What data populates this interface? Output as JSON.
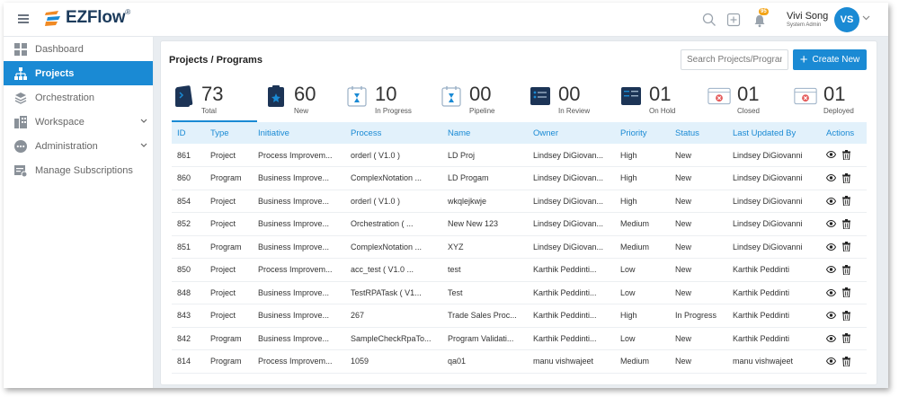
{
  "app": {
    "logo_text": "EZFlow",
    "logo_sup": "®"
  },
  "header": {
    "notification_count": "95",
    "user_name": "Vivi Song",
    "user_role": "System Admin",
    "avatar_initials": "VS"
  },
  "sidebar": {
    "items": [
      {
        "label": "Dashboard",
        "icon": "grid-icon"
      },
      {
        "label": "Projects",
        "icon": "sitemap-icon"
      },
      {
        "label": "Orchestration",
        "icon": "layers-icon"
      },
      {
        "label": "Workspace",
        "icon": "workspace-icon"
      },
      {
        "label": "Administration",
        "icon": "ellipsis-circle-icon"
      },
      {
        "label": "Manage Subscriptions",
        "icon": "subscription-icon"
      }
    ]
  },
  "page": {
    "breadcrumb": "Projects /  Programs",
    "search_placeholder": "Search Projects/Programs",
    "create_label": "Create New"
  },
  "stats": [
    {
      "value": "73",
      "label": "Total"
    },
    {
      "value": "60",
      "label": "New"
    },
    {
      "value": "10",
      "label": "In Progress"
    },
    {
      "value": "00",
      "label": "Pipeline"
    },
    {
      "value": "00",
      "label": "In Review"
    },
    {
      "value": "01",
      "label": "On Hold"
    },
    {
      "value": "01",
      "label": "Closed"
    },
    {
      "value": "01",
      "label": "Deployed"
    }
  ],
  "table": {
    "columns": [
      "ID",
      "Type",
      "Initiative",
      "Process",
      "Name",
      "Owner",
      "Priority",
      "Status",
      "Last Updated By",
      "Actions"
    ],
    "rows": [
      [
        "861",
        "Project",
        "Process Improvem...",
        "orderl ( V1.0 )",
        "LD Proj",
        "Lindsey DiGiovan...",
        "High",
        "New",
        "Lindsey DiGiovanni"
      ],
      [
        "860",
        "Program",
        "Business Improve...",
        "ComplexNotation ...",
        "LD Progam",
        "Lindsey DiGiovan...",
        "High",
        "New",
        "Lindsey DiGiovanni"
      ],
      [
        "854",
        "Project",
        "Business Improve...",
        "orderl ( V1.0 )",
        "wkqlejkwje",
        "Lindsey DiGiovan...",
        "High",
        "New",
        "Lindsey DiGiovanni"
      ],
      [
        "852",
        "Project",
        "Business Improve...",
        "Orchestration ( ...",
        "New New 123",
        "Lindsey DiGiovan...",
        "Medium",
        "New",
        "Lindsey DiGiovanni"
      ],
      [
        "851",
        "Program",
        "Business Improve...",
        "ComplexNotation ...",
        "XYZ",
        "Lindsey DiGiovan...",
        "Medium",
        "New",
        "Lindsey DiGiovanni"
      ],
      [
        "850",
        "Project",
        "Process Improvem...",
        "acc_test ( V1.0 ...",
        "test",
        "Karthik Peddinti...",
        "Low",
        "New",
        "Karthik Peddinti"
      ],
      [
        "848",
        "Project",
        "Business Improve...",
        "TestRPATask ( V1...",
        "Test",
        "Karthik Peddinti...",
        "Low",
        "New",
        "Karthik Peddinti"
      ],
      [
        "843",
        "Project",
        "Business Improve...",
        "267",
        "Trade Sales Proc...",
        "Karthik Peddinti...",
        "High",
        "In Progress",
        "Karthik Peddinti"
      ],
      [
        "842",
        "Program",
        "Business Improve...",
        "SampleCheckRpaTo...",
        "Program Validati...",
        "Karthik Peddinti...",
        "Low",
        "New",
        "Karthik Peddinti"
      ],
      [
        "814",
        "Program",
        "Process Improvem...",
        "1059",
        "qa01",
        "manu vishwajeet",
        "Medium",
        "New",
        "manu vishwajeet"
      ]
    ]
  },
  "colors": {
    "accent": "#1a8ad4",
    "header_bg": "#e2f1fb",
    "badge": "#f3a417",
    "close_red": "#e45b5b"
  }
}
